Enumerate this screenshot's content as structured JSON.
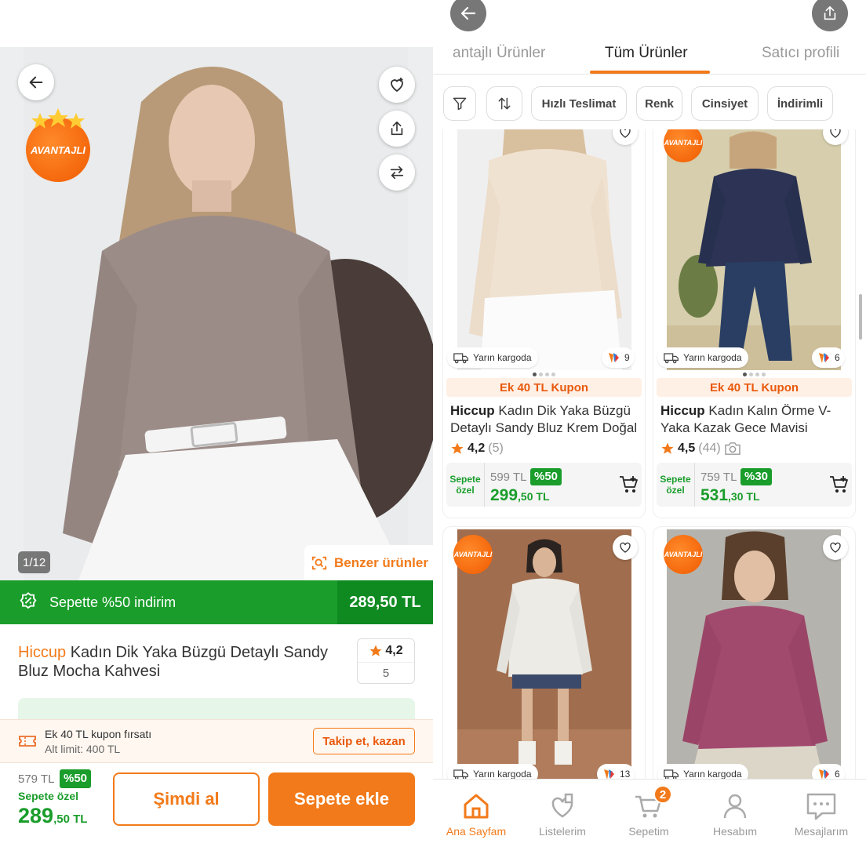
{
  "left": {
    "badge": "AVANTAJLI",
    "counter": "1/12",
    "similar_label": "Benzer ürünler",
    "discount_banner": {
      "text": "Sepette %50 indirim",
      "price": "289,50 TL"
    },
    "product": {
      "brand": "Hiccup",
      "name": " Kadın Dik Yaka Büzgü Detaylı Sandy Bluz Mocha Kahvesi",
      "rating": "4,2",
      "rating_count": "5"
    },
    "coupon": {
      "title": "Ek 40 TL kupon fırsatı",
      "limit": "Alt limit: 400 TL",
      "action": "Takip et, kazan"
    },
    "price": {
      "old": "579 TL",
      "discount": "%50",
      "label": "Sepete özel",
      "main": "289",
      "decimal": ",50 TL"
    },
    "buttons": {
      "buy_now": "Şimdi al",
      "add_to_cart": "Sepete ekle"
    }
  },
  "right": {
    "tabs": [
      "antajlı Ürünler",
      "Tüm Ürünler",
      "Satıcı profili"
    ],
    "filters": [
      "Hızlı Teslimat",
      "Renk",
      "Cinsiyet",
      "İndirimli"
    ],
    "products": [
      {
        "delivery": "Yarın kargoda",
        "colors": "9",
        "coupon": "Ek 40 TL Kupon",
        "brand": "Hiccup",
        "name": " Kadın Dik Yaka Büzgü Detaylı Sandy Bluz Krem Doğal",
        "rating": "4,2",
        "count": "(5)",
        "special": "Sepete özel",
        "old": "599 TL",
        "discount": "%50",
        "price_main": "299",
        "price_dec": ",50 TL"
      },
      {
        "badge": "AVANTAJLI",
        "delivery": "Yarın kargoda",
        "colors": "6",
        "coupon": "Ek 40 TL Kupon",
        "brand": "Hiccup",
        "name": " Kadın Kalın Örme V-Yaka Kazak Gece Mavisi",
        "rating": "4,5",
        "count": "(44)",
        "special": "Sepete özel",
        "old": "759 TL",
        "discount": "%30",
        "price_main": "531",
        "price_dec": ",30 TL"
      },
      {
        "badge": "AVANTAJLI",
        "delivery": "Yarın kargoda",
        "colors": "13"
      },
      {
        "badge": "AVANTAJLI",
        "delivery": "Yarın kargoda",
        "colors": "6"
      }
    ],
    "nav": [
      {
        "label": "Ana Sayfam",
        "icon": "home-icon"
      },
      {
        "label": "Listelerim",
        "icon": "heart-list-icon"
      },
      {
        "label": "Sepetim",
        "icon": "cart-icon",
        "badge": "2"
      },
      {
        "label": "Hesabım",
        "icon": "user-icon"
      },
      {
        "label": "Mesajlarım",
        "icon": "message-icon"
      }
    ]
  },
  "colors": {
    "accent": "#f27a1a",
    "green": "#1a9d2b",
    "dark_green": "#0f8a21"
  }
}
